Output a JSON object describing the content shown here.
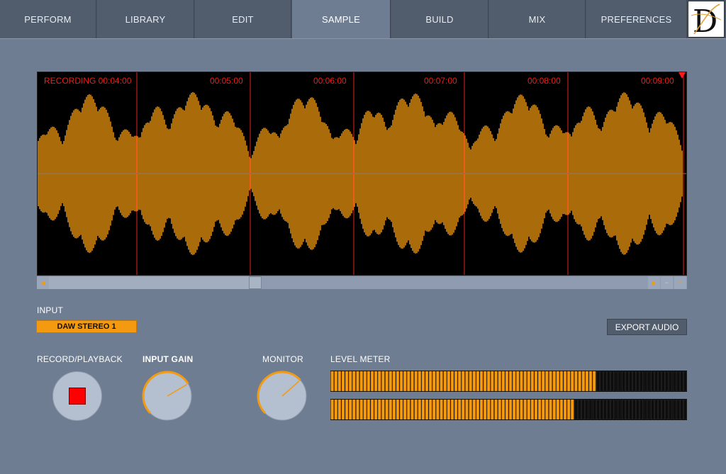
{
  "tabs": [
    {
      "label": "PERFORM",
      "active": false
    },
    {
      "label": "LIBRARY",
      "active": false
    },
    {
      "label": "EDIT",
      "active": false
    },
    {
      "label": "SAMPLE",
      "active": true
    },
    {
      "label": "BUILD",
      "active": false
    },
    {
      "label": "MIX",
      "active": false
    },
    {
      "label": "PREFERENCES",
      "active": false
    }
  ],
  "logo": {
    "icon": "d-logo-icon",
    "letter": "D"
  },
  "waveform": {
    "time_labels": [
      "RECORDING 00:04:00",
      "00:05:00",
      "00:06:00",
      "00:07:00",
      "00:08:00",
      "00:09:00"
    ],
    "wave_color": "#f39a10",
    "marker_color": "#e8201a"
  },
  "scrollbar": {
    "left_icon": "arrow-left-icon",
    "play_icon": "play-icon",
    "zoom_out_icon": "minus-icon",
    "zoom_in_icon": "plus-icon"
  },
  "input": {
    "label": "INPUT",
    "selected": "DAW STEREO 1"
  },
  "export": {
    "label": "EXPORT AUDIO"
  },
  "controls": {
    "record_label": "RECORD/PLAYBACK",
    "gain_label": "INPUT GAIN",
    "monitor_label": "MONITOR",
    "meter_label": "LEVEL METER"
  },
  "knobs": {
    "input_gain_level": 0.72,
    "monitor_level": 0.68
  },
  "level_meter": {
    "left_level": 0.74,
    "right_level": 0.68
  }
}
